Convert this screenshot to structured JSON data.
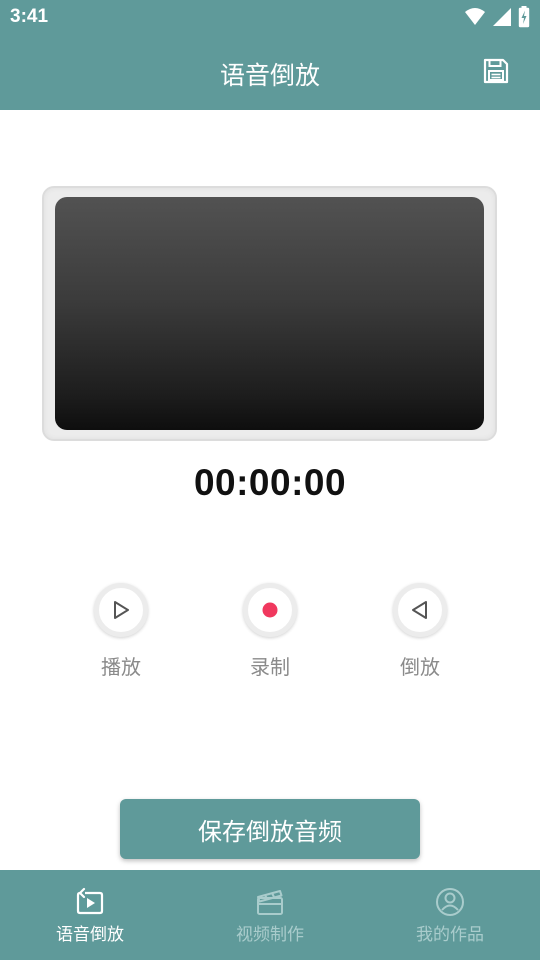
{
  "status_bar": {
    "time": "3:41",
    "icons": [
      "wifi-icon",
      "signal-icon",
      "battery-charging-icon"
    ]
  },
  "header": {
    "title": "语音倒放",
    "save_icon": "floppy-save-icon"
  },
  "display": {
    "timer": "00:00:00"
  },
  "controls": [
    {
      "label": "播放",
      "icon": "play-outline-icon"
    },
    {
      "label": "录制",
      "icon": "record-dot-icon"
    },
    {
      "label": "倒放",
      "icon": "reverse-play-outline-icon"
    }
  ],
  "save_button": {
    "label": "保存倒放音频"
  },
  "bottom_nav": [
    {
      "label": "语音倒放",
      "icon": "reverse-play-icon",
      "active": true
    },
    {
      "label": "视频制作",
      "icon": "clapperboard-icon",
      "active": false
    },
    {
      "label": "我的作品",
      "icon": "user-circle-icon",
      "active": false
    }
  ],
  "colors": {
    "primary": "#5f9a9a",
    "record": "#f0385e",
    "nav_inactive": "#a9cccc",
    "label_gray": "#8a8a8a"
  }
}
